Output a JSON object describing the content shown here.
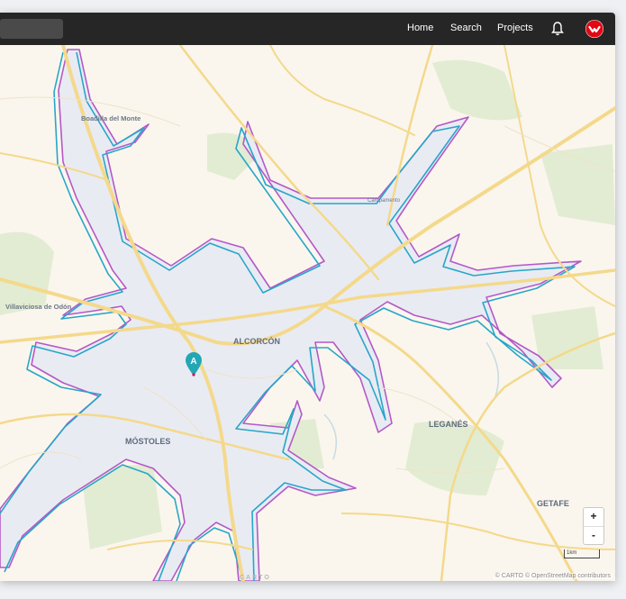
{
  "navbar": {
    "links": [
      "Home",
      "Search",
      "Projects"
    ],
    "icons": [
      "bell-icon",
      "brand-logo-icon"
    ]
  },
  "map": {
    "labels": {
      "boadilla": "Boadilla del Monte",
      "villaviciosa": "Villaviciosa de Odón",
      "alcorcon": "ALCORCÓN",
      "mostoles": "MÓSTOLES",
      "leganes": "LEGANÉS",
      "getafe": "GETAFE",
      "campamento": "Campamento"
    },
    "marker_label": "A",
    "zoom": {
      "in": "+",
      "out": "-"
    },
    "scale_label": "1km",
    "watermark": "CARTO",
    "attribution": "© CARTO © OpenStreetMap contributors",
    "colors": {
      "land": "#faf6ee",
      "roads": "#f4d98b",
      "parks": "#e2ecd2",
      "isochrone_fill": "#e9ebf3",
      "isochrone_outer": "#b558c6",
      "isochrone_inner": "#27a6c8",
      "marker": "#22a7b5"
    }
  }
}
